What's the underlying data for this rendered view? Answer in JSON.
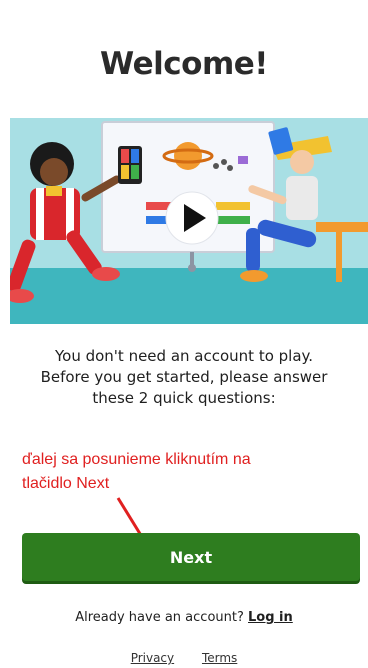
{
  "header": {
    "title": "Welcome!"
  },
  "hero": {
    "icon": "play-icon"
  },
  "intro": {
    "line1": "You don't need an account to play.",
    "line2": "Before you get started, please answer",
    "line3": "these 2 quick questions:"
  },
  "annotation": {
    "line1": "ďalej sa posunieme kliknutím na",
    "line2": "tlačidlo Next",
    "color": "#e02020"
  },
  "next_button": {
    "label": "Next",
    "color": "#2e7d1f"
  },
  "login": {
    "prompt": "Already have an account?",
    "link_label": "Log in"
  },
  "footer": {
    "privacy_label": "Privacy",
    "terms_label": "Terms"
  }
}
